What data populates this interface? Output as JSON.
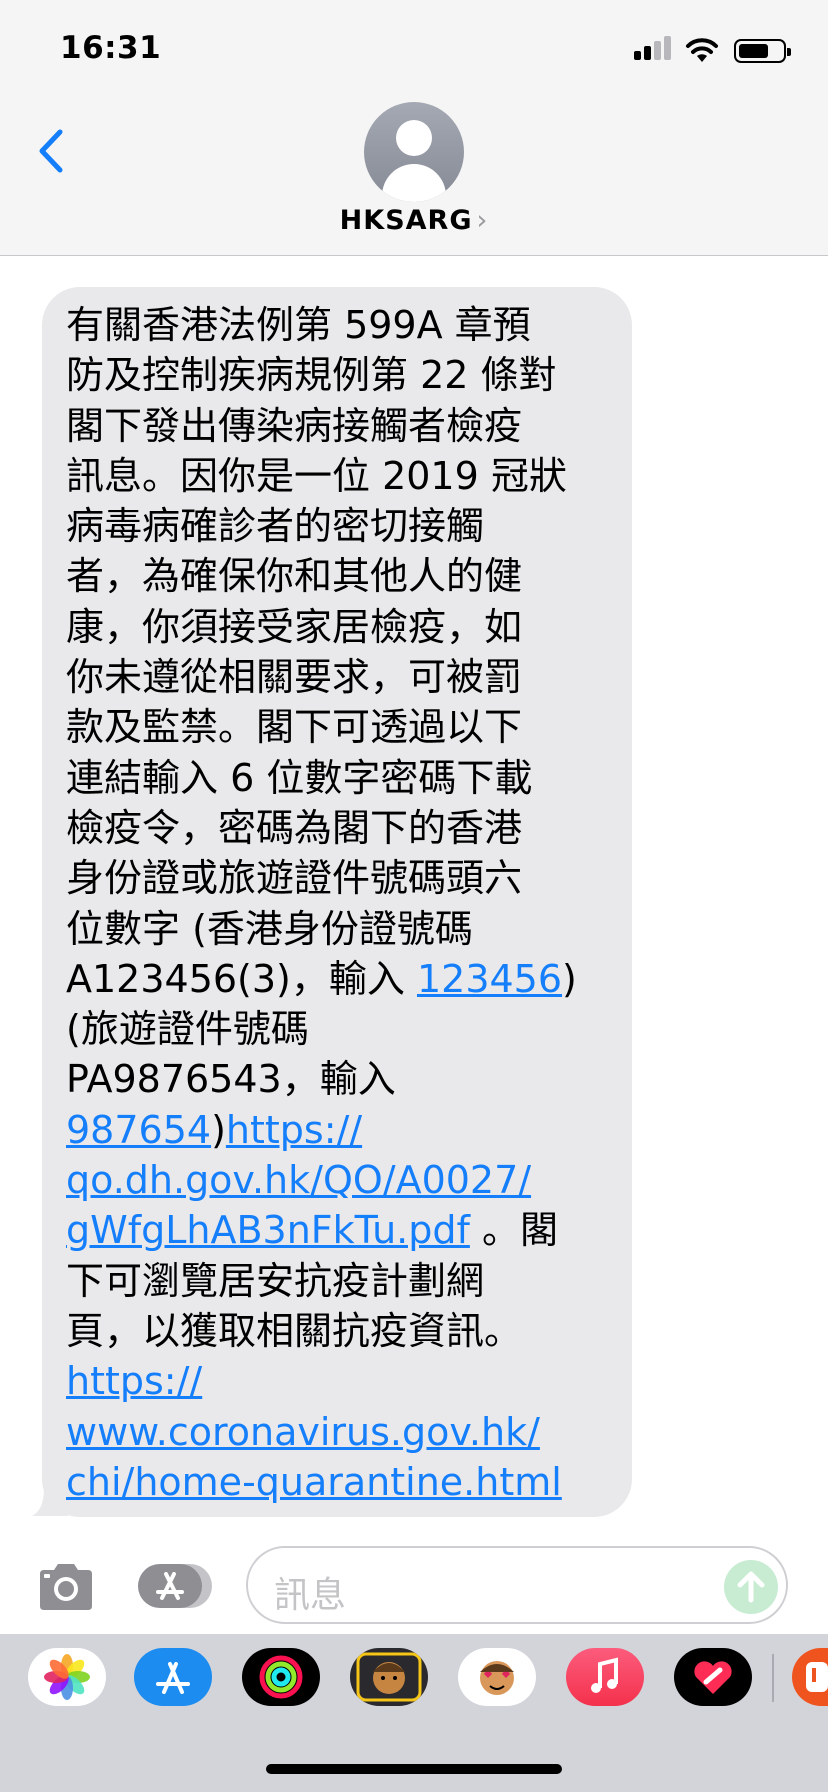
{
  "status_bar": {
    "time": "16:31"
  },
  "conversation": {
    "contact_name": "HKSARG",
    "chevron": "›"
  },
  "message": {
    "lines": [
      {
        "text": "有關香港法例第 599A 章預",
        "link": ""
      },
      {
        "text": "防及控制疾病規例第 22 條對",
        "link": ""
      },
      {
        "text": "閣下發出傳染病接觸者檢疫",
        "link": ""
      },
      {
        "text": "訊息。因你是一位 2019 冠狀",
        "link": ""
      },
      {
        "text": "病毒病確診者的密切接觸",
        "link": ""
      },
      {
        "text": "者，為確保你和其他人的健",
        "link": ""
      },
      {
        "text": "康，你須接受家居檢疫，如",
        "link": ""
      },
      {
        "text": "你未遵從相關要求，可被罰",
        "link": ""
      },
      {
        "text": "款及監禁。閣下可透過以下",
        "link": ""
      },
      {
        "text": "連結輸入 6 位數字密碼下載",
        "link": ""
      },
      {
        "text": "檢疫令，密碼為閣下的香港",
        "link": ""
      },
      {
        "text": "身份證或旅遊證件號碼頭六",
        "link": ""
      },
      {
        "text": "位數字 (香港身份證號碼",
        "link": ""
      }
    ],
    "line14_pre": "A123456(3)，輸入 ",
    "line14_link": "123456",
    "line14_post": ")",
    "line15": "(旅遊證件號碼",
    "line16": "PA9876543，輸入",
    "line17_link1": "987654",
    "line17_mid": ")",
    "line17_link2": "https://",
    "line18_link": "qo.dh.gov.hk/QO/A0027/",
    "line19_link": "gWfgLhAB3nFkTu.pdf",
    "line19_post": " 。閣",
    "line20": "下可瀏覽居安抗疫計劃網",
    "line21": "頁，以獲取相關抗疫資訊。",
    "line22_link": "https://",
    "line23_link": "www.coronavirus.gov.hk/",
    "line24_link": "chi/home-quarantine.html"
  },
  "input_bar": {
    "placeholder": "訊息"
  },
  "app_drawer": {
    "apps": [
      "photos-icon",
      "app-store-icon",
      "activity-icon",
      "memoji-icon",
      "animoji-icon",
      "music-icon",
      "heart-digital-touch-icon",
      "partial-app-icon"
    ]
  },
  "colors": {
    "link": "#147efb",
    "bubble": "#e9e9eb",
    "header_bg": "#f5f5f5",
    "send_disabled": "#c7ecd2"
  }
}
